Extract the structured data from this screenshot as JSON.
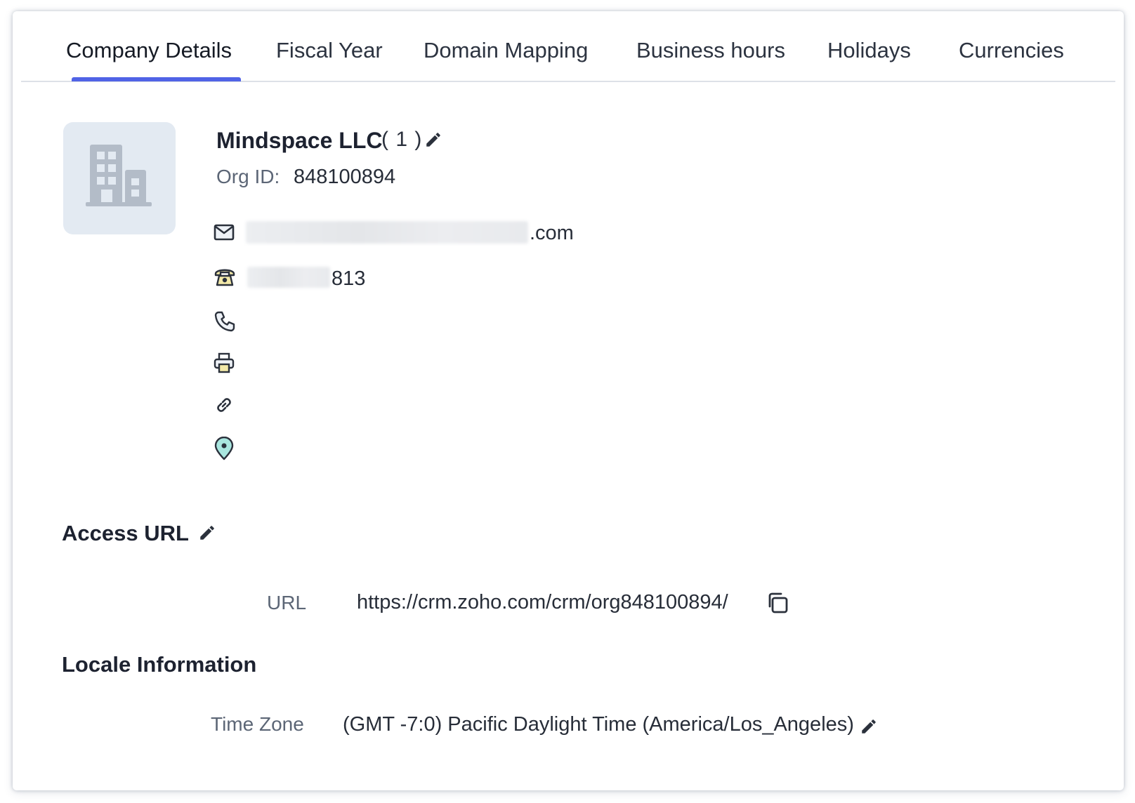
{
  "tabs": [
    {
      "label": "Company Details",
      "active": true
    },
    {
      "label": "Fiscal Year",
      "active": false
    },
    {
      "label": "Domain Mapping",
      "active": false
    },
    {
      "label": "Business hours",
      "active": false
    },
    {
      "label": "Holidays",
      "active": false
    },
    {
      "label": "Currencies",
      "active": false
    }
  ],
  "company": {
    "name": "Mindspace LLC",
    "count": "( 1 )",
    "org_id_label": "Org ID:",
    "org_id": "848100894",
    "email_visible_suffix": ".com",
    "phone_visible_suffix": "813",
    "icons": [
      "mail-icon",
      "telephone-icon",
      "mobile-phone-icon",
      "fax-printer-icon",
      "website-link-icon",
      "location-pin-icon"
    ]
  },
  "access_url": {
    "title": "Access URL",
    "url_label": "URL",
    "url_value": "https://crm.zoho.com/crm/org848100894/"
  },
  "locale": {
    "title": "Locale Information",
    "timezone_label": "Time Zone",
    "timezone_value": "(GMT -7:0) Pacific Daylight Time (America/Los_Angeles)"
  },
  "colors": {
    "accent": "#5063e6",
    "logo_bg": "#e3eaf2",
    "icon_accent_yellow": "#f3e9a8",
    "icon_accent_teal": "#a9e6df"
  }
}
